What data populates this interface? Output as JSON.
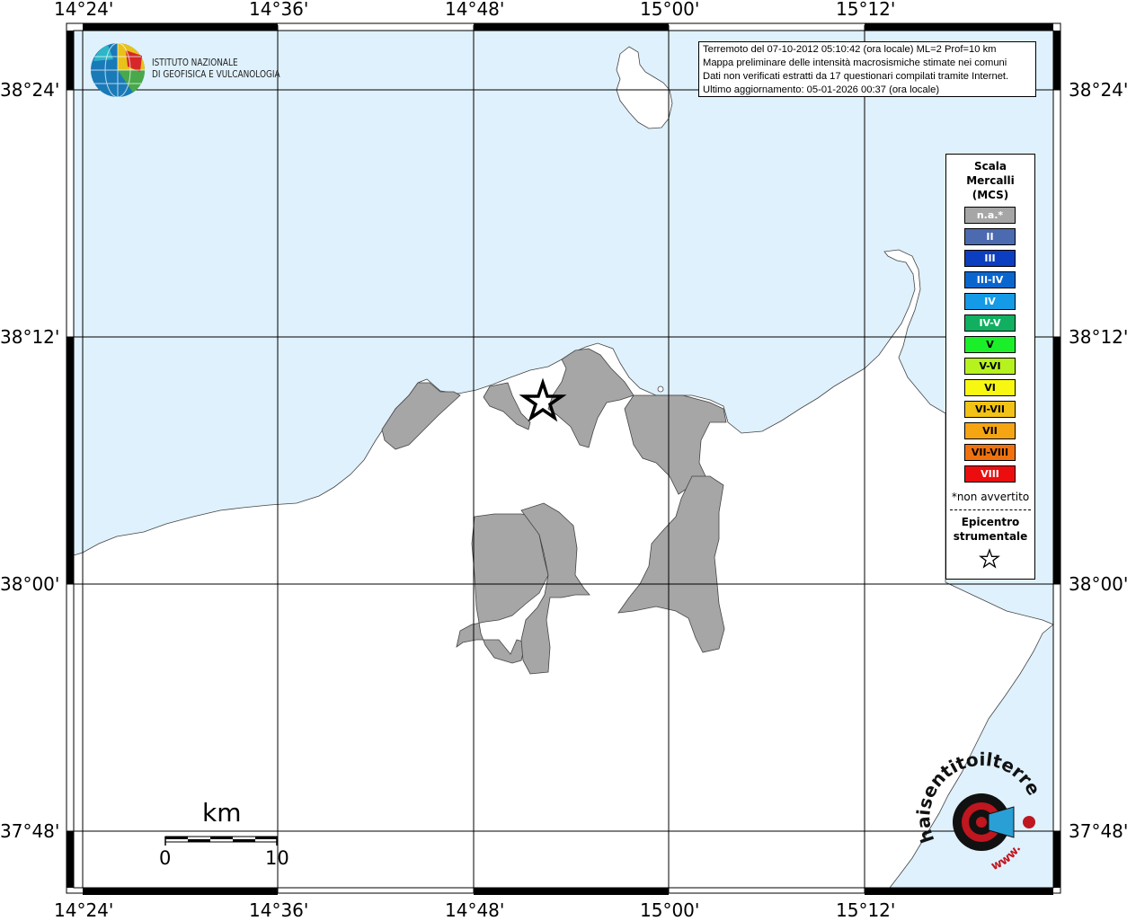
{
  "map": {
    "lon_ticks": [
      "14°24'",
      "14°36'",
      "14°48'",
      "15°00'",
      "15°12'"
    ],
    "lat_ticks": [
      "38°24'",
      "38°12'",
      "38°00'",
      "37°48'"
    ],
    "colors": {
      "sea": "#dff1fc",
      "land": "#ffffff",
      "municipality": "#a6a6a6",
      "grid": "#000000"
    }
  },
  "logo": {
    "line1": "ISTITUTO NAZIONALE",
    "line2": "DI GEOFISICA E VULCANOLOGIA"
  },
  "info": {
    "line1": "Terremoto del 07-10-2012 05:10:42 (ora locale) ML=2 Prof=10 km",
    "line2": "Mappa preliminare delle intensità macrosismiche stimate nei comuni",
    "line3": "Dati non verificati estratti da 17 questionari compilati tramite Internet.",
    "line4": "Ultimo aggiornamento: 05-01-2026 00:37 (ora locale)"
  },
  "legend": {
    "title1": "Scala",
    "title2": "Mercalli",
    "title3": "(MCS)",
    "items": [
      {
        "label": "n.a.*",
        "color": "#a6a6a6"
      },
      {
        "label": "II",
        "color": "#4b6ab0"
      },
      {
        "label": "III",
        "color": "#0b3ec0"
      },
      {
        "label": "III-IV",
        "color": "#0a66cf"
      },
      {
        "label": "IV",
        "color": "#149ae6"
      },
      {
        "label": "IV-V",
        "color": "#10b060"
      },
      {
        "label": "V",
        "color": "#1bef2a"
      },
      {
        "label": "V-VI",
        "color": "#b6f21e"
      },
      {
        "label": "VI",
        "color": "#f7f712"
      },
      {
        "label": "VI-VII",
        "color": "#f2c316"
      },
      {
        "label": "VII",
        "color": "#f5a512"
      },
      {
        "label": "VII-VIII",
        "color": "#f0720e"
      },
      {
        "label": "VIII",
        "color": "#ec0e0e"
      }
    ],
    "note": "*non avvertito",
    "epi1": "Epicentro",
    "epi2": "strumentale"
  },
  "scale": {
    "unit": "km",
    "start": "0",
    "end": "10"
  },
  "watermark": {
    "text1": "haisentitoilterremoto.it",
    "text2": "www."
  }
}
